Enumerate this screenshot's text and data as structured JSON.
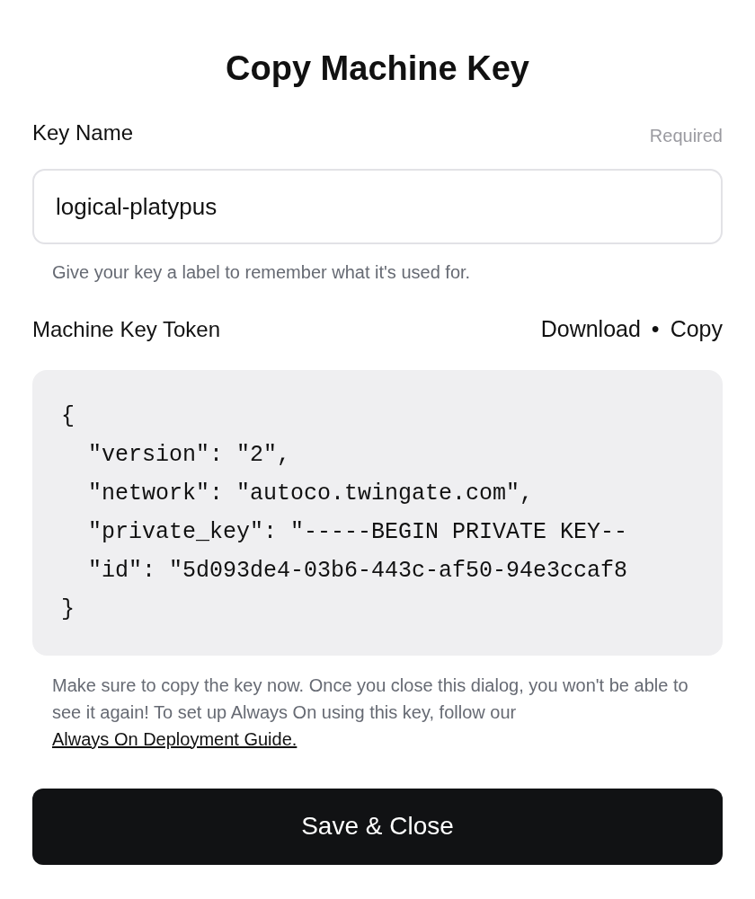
{
  "title": "Copy Machine Key",
  "key_name": {
    "label": "Key Name",
    "hint": "Required",
    "value": "logical-platypus",
    "help": "Give your key a label to remember what it's used for."
  },
  "token": {
    "label": "Machine Key Token",
    "actions": [
      "Download",
      "Copy"
    ],
    "separator": "•",
    "lines": [
      "{",
      "  \"version\": \"2\",",
      "  \"network\": \"autoco.twingate.com\",",
      "  \"private_key\": \"-----BEGIN PRIVATE KEY--",
      "  \"id\": \"5d093de4-03b6-443c-af50-94e3ccaf8",
      "}"
    ]
  },
  "note": {
    "text": "Make sure to copy the key now. Once you close this dialog, you won't be able to see it again! To set up Always On using this key, follow our",
    "link": "Always On Deployment Guide."
  },
  "button": "Save & Close"
}
